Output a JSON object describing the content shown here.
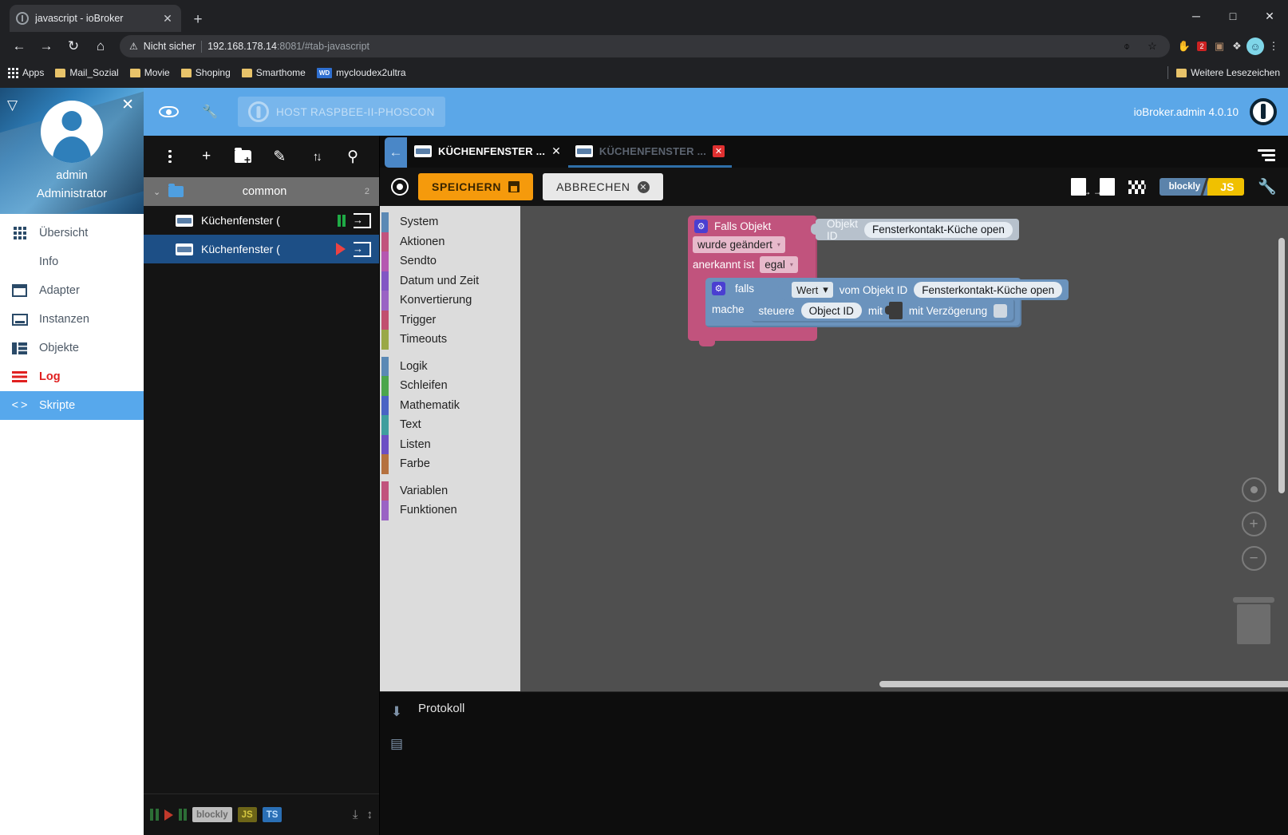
{
  "browser": {
    "tab": {
      "title": "javascript - ioBroker",
      "favicon": "iobroker-favicon",
      "close": "✕"
    },
    "newtab": "+",
    "window": {
      "minimize": "─",
      "maximize": "□",
      "close": "✕"
    },
    "nav": {
      "back": "←",
      "forward": "→",
      "reload": "↻",
      "home": "⌂"
    },
    "omnibox": {
      "warning_icon": "⚠",
      "security_label": "Nicht sicher",
      "url_host": "192.168.178.14",
      "url_rest": ":8081/#tab-javascript",
      "eye_off_icon": "⌽",
      "star_icon": "☆"
    },
    "extensions": [
      {
        "name": "adblock-extension",
        "glyph": "✋"
      },
      {
        "name": "notes-extension",
        "glyph": "☰",
        "badge": "2"
      },
      {
        "name": "screenshot-extension",
        "glyph": "▣"
      },
      {
        "name": "puzzle-extension",
        "glyph": "❖"
      },
      {
        "name": "profile-avatar",
        "glyph": "☺"
      },
      {
        "name": "chrome-menu",
        "glyph": "⋮"
      }
    ],
    "bookmarks": [
      {
        "label": "Apps",
        "icon": "apps-grid-icon"
      },
      {
        "label": "Mail_Sozial",
        "icon": "folder-icon"
      },
      {
        "label": "Movie",
        "icon": "folder-icon"
      },
      {
        "label": "Shoping",
        "icon": "folder-icon"
      },
      {
        "label": "Smarthome",
        "icon": "folder-icon"
      },
      {
        "label": "mycloudex2ultra",
        "icon": "wd-icon"
      }
    ],
    "more_bookmarks": "Weitere Lesezeichen"
  },
  "sidebar": {
    "collapse_icon": "▽",
    "close_icon": "✕",
    "username": "admin",
    "role": "Administrator",
    "items": [
      {
        "label": "Übersicht",
        "icon": "grid-icon"
      },
      {
        "label": "Info",
        "icon": "info-icon"
      },
      {
        "label": "Adapter",
        "icon": "adapter-icon"
      },
      {
        "label": "Instanzen",
        "icon": "instances-icon"
      },
      {
        "label": "Objekte",
        "icon": "objects-icon"
      },
      {
        "label": "Log",
        "icon": "log-icon"
      },
      {
        "label": "Skripte",
        "icon": "code-icon"
      }
    ]
  },
  "header": {
    "eye_icon": "eye-icon",
    "wrench_icon": "🔧",
    "host_label": "HOST RASPBEE-II-PHOSCON",
    "version": "ioBroker.admin 4.0.10"
  },
  "tree": {
    "toolbar": [
      {
        "name": "more-menu-button",
        "glyph": "⋮"
      },
      {
        "name": "add-script-button",
        "glyph": "+"
      },
      {
        "name": "add-folder-button",
        "glyph": "folder-plus"
      },
      {
        "name": "rename-button",
        "glyph": "✎"
      },
      {
        "name": "expand-collapse-button",
        "glyph": "⇅"
      },
      {
        "name": "search-button",
        "glyph": "⚲"
      }
    ],
    "folder": {
      "name": "common",
      "count": "2",
      "chevron": "⌄"
    },
    "scripts": [
      {
        "name": "Küchenfenster (",
        "state": "paused",
        "selected": false
      },
      {
        "name": "Küchenfenster (",
        "state": "running",
        "selected": true
      }
    ],
    "bottom": {
      "pause_all": "pause-icon",
      "run": "play-icon",
      "pause": "pause-icon",
      "blockly_badge": "blockly",
      "js_badge": "JS",
      "ts_badge": "TS",
      "collapse_icon": "⌃⌄",
      "expand_icon": "⌃⌄"
    }
  },
  "editor": {
    "back_arrow": "←",
    "tabs": [
      {
        "label": "KÜCHENFENSTER ...",
        "close": "✕",
        "active": true
      },
      {
        "label": "KÜCHENFENSTER ...",
        "close": "✕",
        "active": false
      }
    ],
    "menu_icon": "hamburger-icon",
    "toolbar": {
      "center_label": "center-blocks",
      "save_label": "SPEICHERN",
      "cancel_label": "ABBRECHEN",
      "export_label": "export-blocks",
      "import_label": "import-blocks",
      "checkered_label": "start-debug",
      "toggle_left": "blockly",
      "toggle_right": "JS",
      "settings_icon": "🔧"
    }
  },
  "toolbox": {
    "groups": [
      [
        {
          "label": "System",
          "color": "#5b89b5"
        },
        {
          "label": "Aktionen",
          "color": "#c1537d"
        },
        {
          "label": "Sendto",
          "color": "#b557b0"
        },
        {
          "label": "Datum und Zeit",
          "color": "#8256c4"
        },
        {
          "label": "Konvertierung",
          "color": "#9a63c4"
        },
        {
          "label": "Trigger",
          "color": "#c14f6f"
        },
        {
          "label": "Timeouts",
          "color": "#9aa847"
        }
      ],
      [
        {
          "label": "Logik",
          "color": "#5b89b5"
        },
        {
          "label": "Schleifen",
          "color": "#4ca64c"
        },
        {
          "label": "Mathematik",
          "color": "#4a63c4"
        },
        {
          "label": "Text",
          "color": "#3f9e9e"
        },
        {
          "label": "Listen",
          "color": "#6b4fc4"
        },
        {
          "label": "Farbe",
          "color": "#b5713f"
        }
      ],
      [
        {
          "label": "Variablen",
          "color": "#c1537d"
        },
        {
          "label": "Funktionen",
          "color": "#9a63c4"
        }
      ]
    ]
  },
  "blocks": {
    "trigger": {
      "gear": "⚙",
      "title": "Falls Objekt",
      "objid_label": "Objekt ID",
      "objid_value": "Fensterkontakt-Küche open",
      "change_field": "wurde geändert",
      "ack_label": "anerkannt ist",
      "ack_field": "egal",
      "carat": "▾"
    },
    "if": {
      "gear": "⚙",
      "if_label": "falls",
      "value_field": "Wert",
      "from_label": "vom Objekt ID",
      "from_value": "Fensterkontakt-Küche open",
      "do_label": "mache",
      "control_label": "steuere",
      "control_objid": "Object ID",
      "with_label": "mit",
      "delay_label": "mit Verzögerung"
    }
  },
  "canvas": {
    "zoom_center": "center-icon",
    "zoom_in": "+",
    "zoom_out": "−",
    "trash": "trash-icon"
  },
  "protokoll": {
    "title": "Protokoll",
    "download_icon": "⬇",
    "clear_icon": "▤"
  }
}
